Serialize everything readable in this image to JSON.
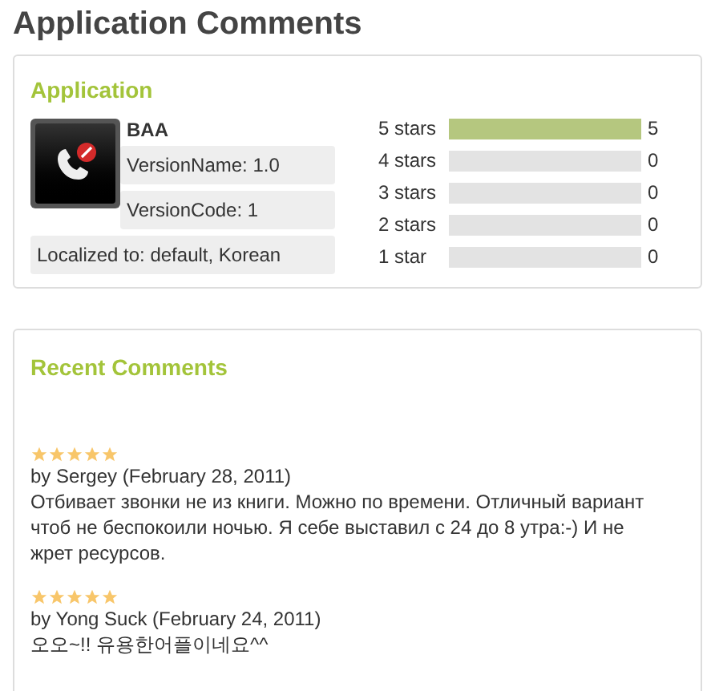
{
  "title": "Application Comments",
  "application": {
    "heading": "Application",
    "name": "BAA",
    "version_name": "VersionName: 1.0",
    "version_code": "VersionCode: 1",
    "localized": "Localized to: default, Korean",
    "ratings": [
      {
        "label": "5 stars",
        "level": 1,
        "count": "5"
      },
      {
        "label": "4 stars",
        "level": 0,
        "count": "0"
      },
      {
        "label": "3 stars",
        "level": 0,
        "count": "0"
      },
      {
        "label": "2 stars",
        "level": 0,
        "count": "0"
      },
      {
        "label": "1 star",
        "level": 0,
        "count": "0"
      }
    ]
  },
  "recent": {
    "heading": "Recent Comments",
    "comments": [
      {
        "stars": 5,
        "byline": "by Sergey (February 28, 2011)",
        "text": "Отбивает звонки не из книги. Можно по времени. Отличный вариант чтоб не беспокоили ночью. Я себе выставил с 24 до 8 утра:-) И не жрет ресурсов."
      },
      {
        "stars": 5,
        "byline": "by Yong Suck (February 24, 2011)",
        "text": "오오~!! 유용한어플이네요^^"
      }
    ]
  }
}
